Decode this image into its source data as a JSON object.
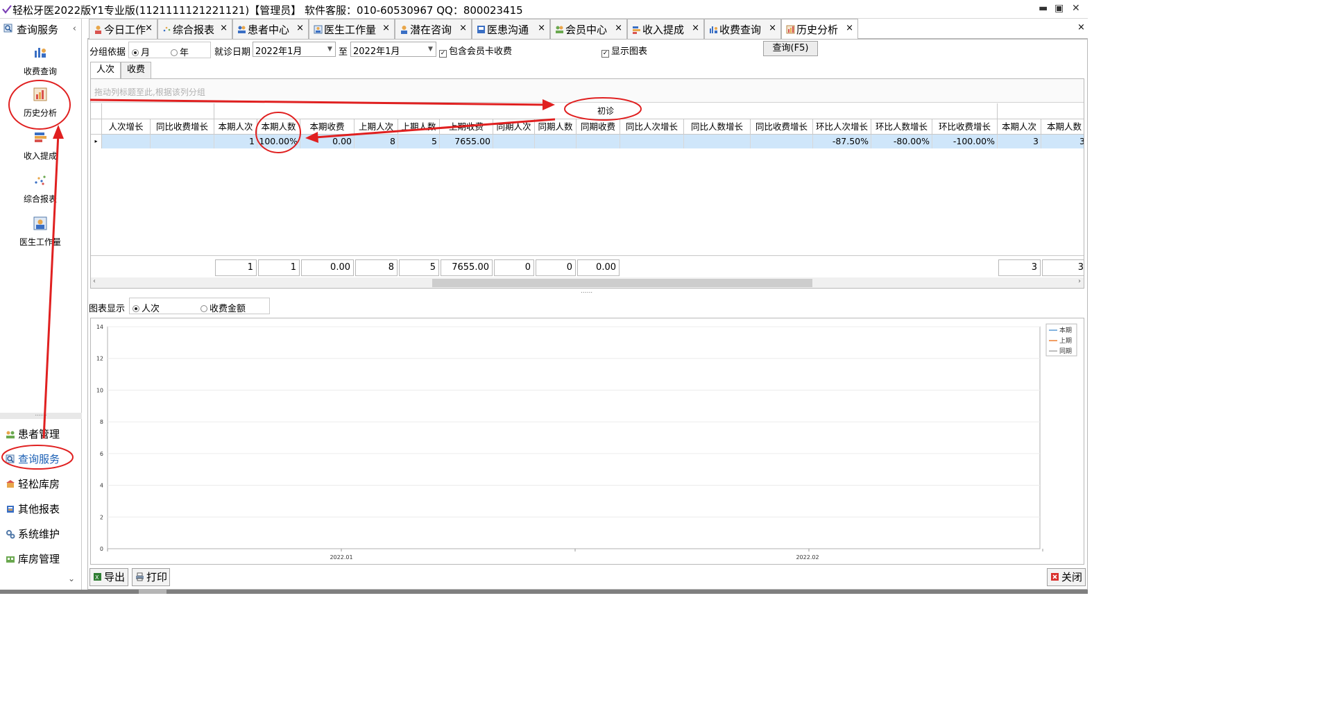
{
  "window": {
    "title": "轻松牙医2022版Y1专业版(1121111121221121)【管理员】    软件客服：010-60530967 QQ：800023415",
    "minimize": "▬",
    "maximize": "▣",
    "close": "✕"
  },
  "sidebar": {
    "header": "查询服务",
    "collapse": "‹",
    "nav": [
      {
        "label": "收费查询",
        "icon": "bar-chart-person-icon"
      },
      {
        "label": "历史分析",
        "icon": "history-chart-icon"
      },
      {
        "label": "收入提成",
        "icon": "stacked-bars-icon"
      },
      {
        "label": "综合报表",
        "icon": "scatter-dots-icon"
      },
      {
        "label": "医生工作量",
        "icon": "doctor-workload-icon"
      }
    ],
    "splitter": "......",
    "modules": [
      {
        "label": "患者管理",
        "icon": "people-icon",
        "active": false
      },
      {
        "label": "查询服务",
        "icon": "magnifier-icon",
        "active": true
      },
      {
        "label": "轻松库房",
        "icon": "warehouse-box-icon",
        "active": false
      },
      {
        "label": "其他报表",
        "icon": "report-book-icon",
        "active": false
      },
      {
        "label": "系统维护",
        "icon": "gears-icon",
        "active": false
      },
      {
        "label": "库房管理",
        "icon": "storage-icon",
        "active": false
      }
    ],
    "expand": "⌄"
  },
  "tabs": [
    {
      "label": "今日工作",
      "icon": "person-work-icon"
    },
    {
      "label": "综合报表",
      "icon": "scatter-dots-icon"
    },
    {
      "label": "患者中心",
      "icon": "patient-center-icon"
    },
    {
      "label": "医生工作量",
      "icon": "doctor-workload-icon"
    },
    {
      "label": "潜在咨询",
      "icon": "consult-person-icon"
    },
    {
      "label": "医患沟通",
      "icon": "communication-icon"
    },
    {
      "label": "会员中心",
      "icon": "members-icon"
    },
    {
      "label": "收入提成",
      "icon": "stacked-bars-icon"
    },
    {
      "label": "收费查询",
      "icon": "bar-chart-person-icon"
    },
    {
      "label": "历史分析",
      "icon": "history-chart-icon",
      "active": true
    }
  ],
  "tab_close": "×",
  "filters": {
    "group_by_label": "分组依据",
    "group_by_options": [
      "月",
      "年"
    ],
    "group_by_selected": "月",
    "date_label": "就诊日期",
    "date_from": "2022年1月",
    "date_to_label": "至",
    "date_to": "2022年1月",
    "include_member_card": "包含会员卡收费",
    "include_member_card_checked": true,
    "show_chart": "显示图表",
    "show_chart_checked": true,
    "query_button": "查询(F5)"
  },
  "subtabs": [
    "人次",
    "收费"
  ],
  "grid": {
    "group_hint": "拖动列标题至此,根据该列分组",
    "band": "初诊",
    "columns": [
      "人次增长",
      "同比收费增长",
      "本期人次",
      "本期人数",
      "本期收费",
      "上期人次",
      "上期人数",
      "上期收费",
      "同期人次",
      "同期人数",
      "同期收费",
      "同比人次增长",
      "同比人数增长",
      "同比收费增长",
      "环比人次增长",
      "环比人数增长",
      "环比收费增长",
      "本期人次",
      "本期人数"
    ],
    "row": [
      "",
      "",
      "1",
      "100.00%",
      "0.00",
      "8",
      "5",
      "7655.00",
      "",
      "",
      "",
      "",
      "",
      "",
      "-87.50%",
      "-80.00%",
      "-100.00%",
      "3",
      "3"
    ],
    "row_indicator": "▸",
    "footer": [
      "",
      "",
      "1",
      "1",
      "0.00",
      "8",
      "5",
      "7655.00",
      "0",
      "0",
      "0.00",
      "",
      "",
      "",
      "",
      "",
      "",
      "3",
      "3"
    ],
    "scroll_left": "‹",
    "scroll_right": "›"
  },
  "chart_controls": {
    "label": "图表显示",
    "options": [
      "人次",
      "收费金额"
    ],
    "selected": "人次"
  },
  "chart_data": {
    "type": "line",
    "x": [
      "2022.01",
      "2022.02"
    ],
    "ylim": [
      0,
      14
    ],
    "yticks": [
      "0",
      "2",
      "4",
      "6",
      "8",
      "10",
      "12",
      "14"
    ],
    "series": [
      {
        "name": "本期",
        "values": [],
        "color": "#5b9bd5"
      },
      {
        "name": "上期",
        "values": [],
        "color": "#ed7d31"
      },
      {
        "name": "同期",
        "values": [],
        "color": "#a5a5a5"
      }
    ],
    "grid": true,
    "legend": "top-right"
  },
  "bottom_buttons": {
    "export": "导出",
    "print": "打印",
    "close": "关闭"
  }
}
